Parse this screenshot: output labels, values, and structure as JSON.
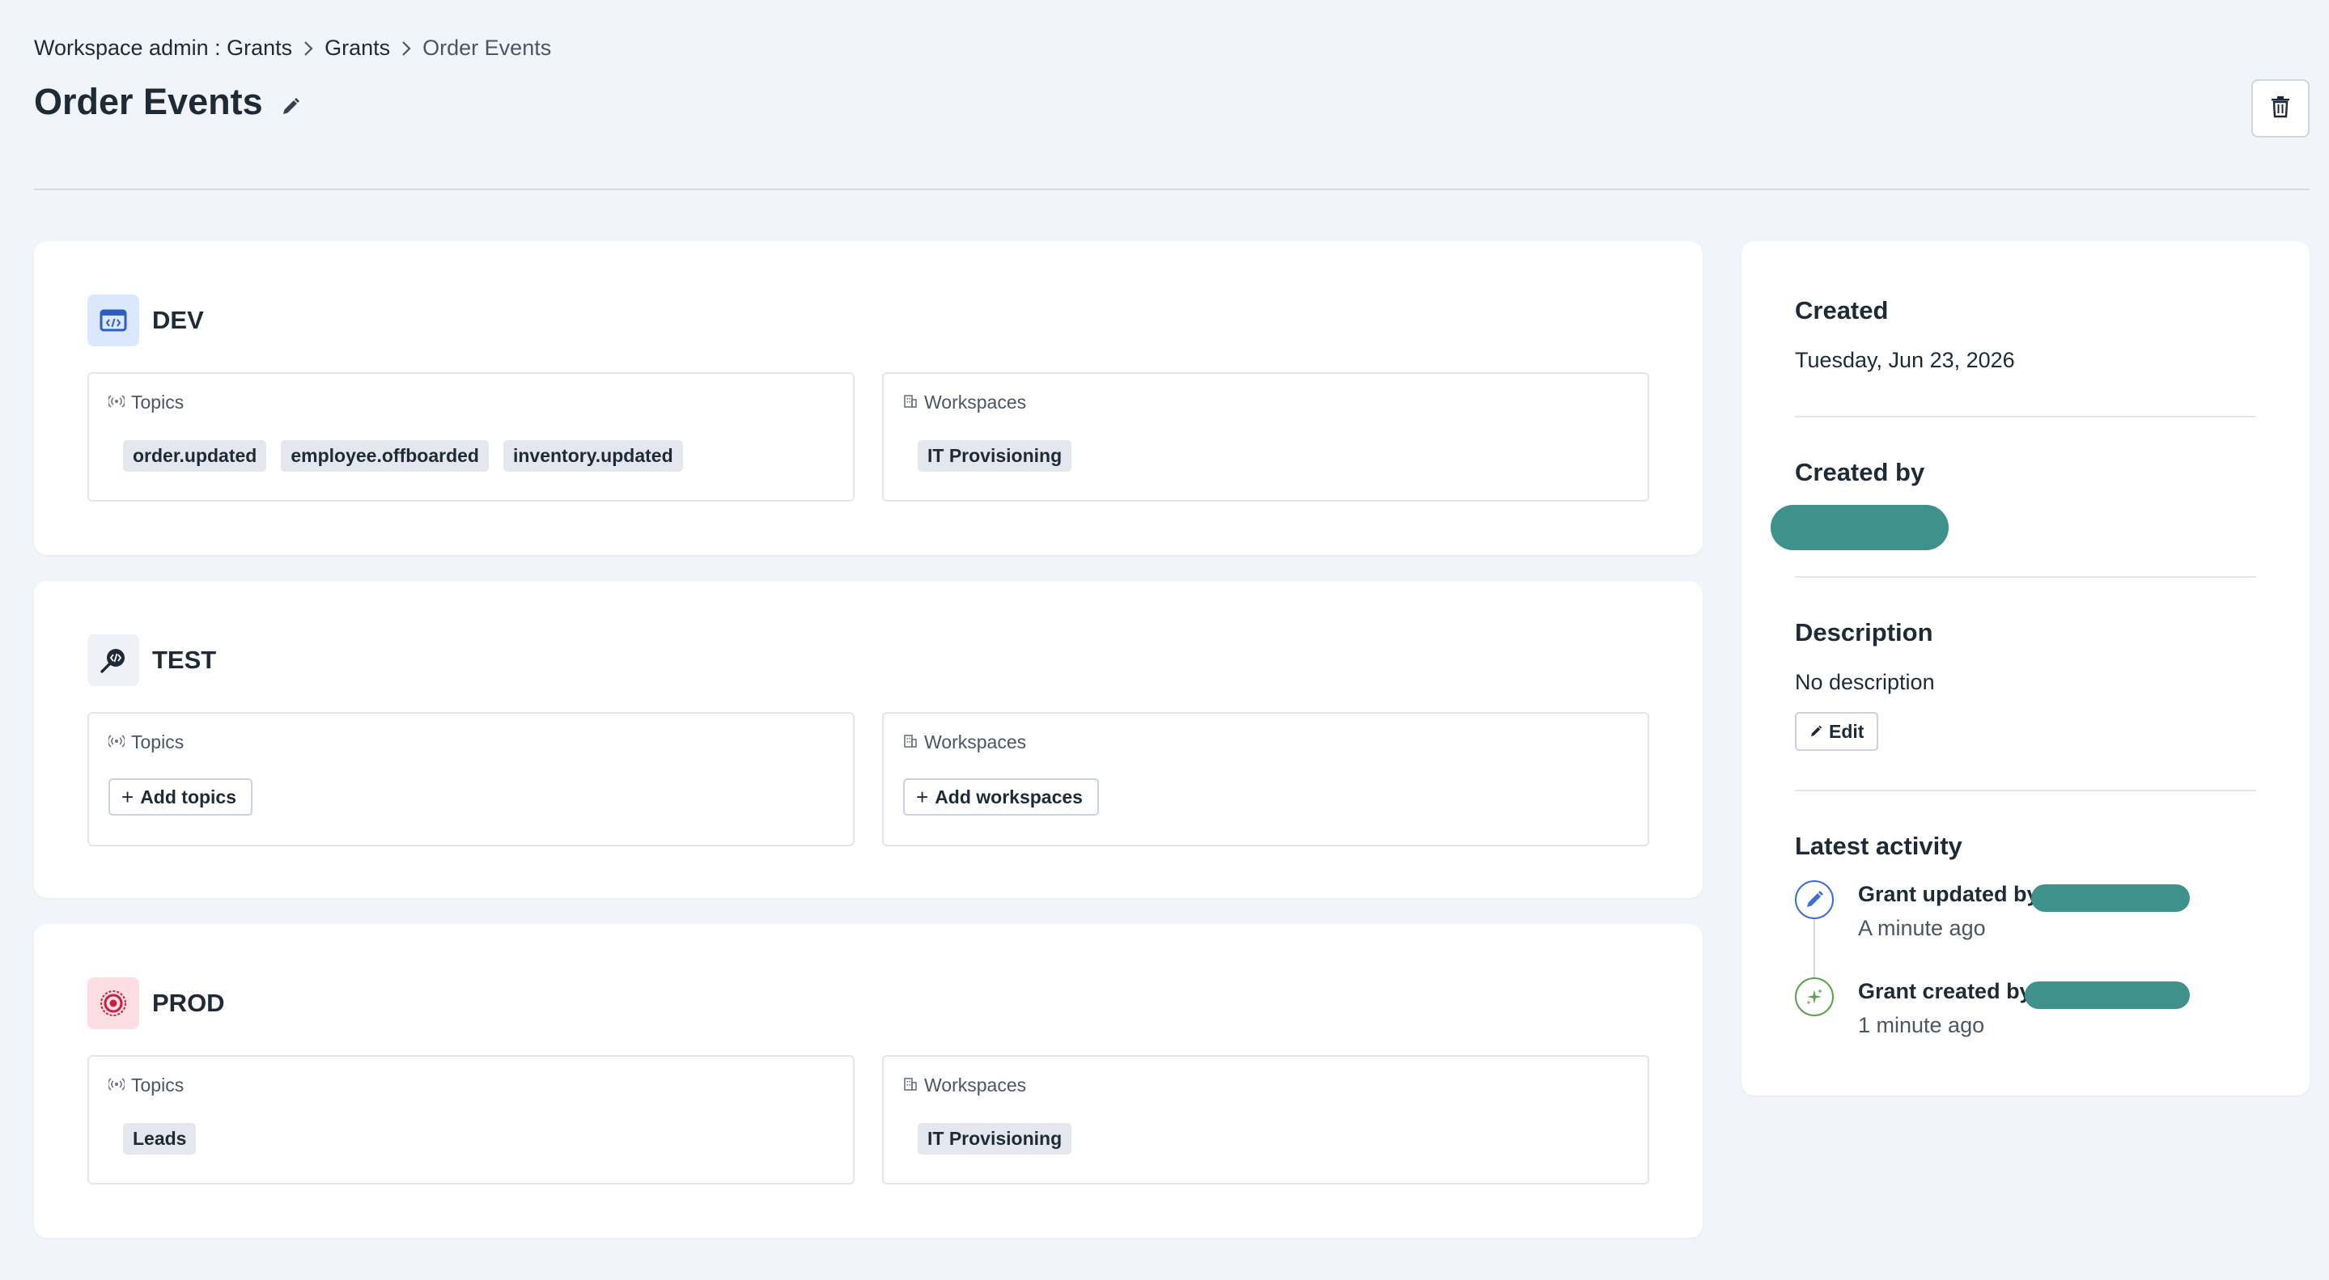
{
  "breadcrumb": {
    "items": [
      "Workspace admin : Grants",
      "Grants"
    ],
    "current": "Order Events"
  },
  "page": {
    "title": "Order Events"
  },
  "environments": [
    {
      "name": "DEV",
      "icon": "code-window-icon",
      "topics_label": "Topics",
      "workspaces_label": "Workspaces",
      "topics": [
        "order.updated",
        "employee.offboarded",
        "inventory.updated"
      ],
      "workspaces": [
        "IT Provisioning"
      ]
    },
    {
      "name": "TEST",
      "icon": "code-search-icon",
      "topics_label": "Topics",
      "workspaces_label": "Workspaces",
      "add_topics_label": "Add topics",
      "add_workspaces_label": "Add workspaces"
    },
    {
      "name": "PROD",
      "icon": "target-icon",
      "topics_label": "Topics",
      "workspaces_label": "Workspaces",
      "topics": [
        "Leads"
      ],
      "workspaces": [
        "IT Provisioning"
      ]
    }
  ],
  "sidebar": {
    "created_label": "Created",
    "created_value": "Tuesday, Jun 23, 2026",
    "created_by_label": "Created by",
    "description_label": "Description",
    "description_value": "No description",
    "edit_label": "Edit",
    "activity_label": "Latest activity",
    "activity": [
      {
        "title": "Grant updated by",
        "time": "A minute ago",
        "icon": "pencil-icon"
      },
      {
        "title": "Grant created by",
        "time": "1 minute ago",
        "icon": "sparkle-icon"
      }
    ]
  },
  "colors": {
    "background": "#f1f4f8",
    "redaction": "#3f918b",
    "dev_icon_bg": "#dbe7fb",
    "prod_icon_bg": "#fbdde3",
    "prod_accent": "#c4213f"
  }
}
